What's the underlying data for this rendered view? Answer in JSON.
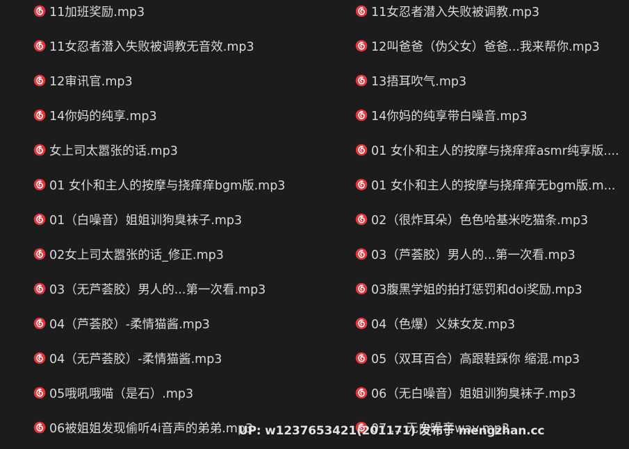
{
  "icon": "netease-music-icon",
  "icon_color": "#e8363f",
  "background_color": "#1c1c1c",
  "text_color": "#d9d9d9",
  "files": {
    "left": [
      "11加班奖励.mp3",
      "11女忍者潜入失败被调教无音效.mp3",
      "12审讯官.mp3",
      "14你妈的纯享.mp3",
      "女上司太嚣张的话.mp3",
      "01 女仆和主人的按摩与挠痒痒bgm版.mp3",
      "01（白噪音）姐姐训狗臭袜子.mp3",
      "02女上司太嚣张的话_修正.mp3",
      "03（无芦荟胶）男人的...第一次看.mp3",
      "04（芦荟胶）-柔情猫酱.mp3",
      "04（无芦荟胶）-柔情猫酱.mp3",
      "05哦吼哦喵（是石）.mp3",
      "06被姐姐发现偷听4i音声的弟弟.mp3"
    ],
    "right": [
      "11女忍者潜入失败被调教.mp3",
      "12叫爸爸（伪父女）爸爸...我来帮你.mp3",
      "13捂耳吹气.mp3",
      "14你妈的纯享带白噪音.mp3",
      "01 女仆和主人的按摩与挠痒痒asmr纯享版....",
      "01 女仆和主人的按摩与挠痒痒无bgm版.m...",
      "02（很炸耳朵）色色哈基米吃猫条.mp3",
      "03（芦荟胶）男人的...第一次看.mp3",
      "03腹黑学姐的拍打惩罚和doi奖励.mp3",
      "04（色爆）义妹女友.mp3",
      "05（双耳百合）高跟鞋踩你 缩混.mp3",
      "06（无白噪音）姐姐训狗臭袜子.mp3",
      "07 ... 无白噪音wav.mp3"
    ]
  },
  "watermark": "UP: w1237653421(201171) 发布于 mengzhan.cc"
}
